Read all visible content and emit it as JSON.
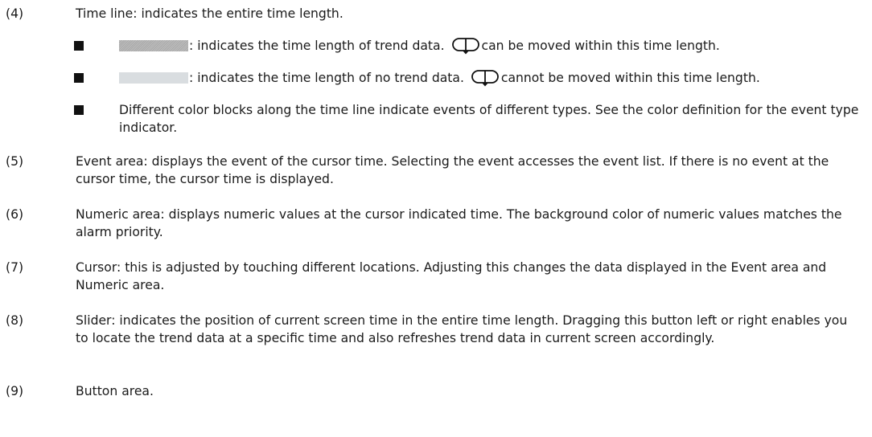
{
  "items": [
    {
      "num": "(4)",
      "text": "Time line: indicates the entire time length.",
      "bullets": [
        {
          "swatch": "trend",
          "pre": ": indicates the time length of trend data.",
          "post": "can be moved within this time length."
        },
        {
          "swatch": "notrend",
          "pre": ": indicates the time length of no trend data.",
          "post": "cannot be moved within this time length."
        },
        {
          "text": "Different color blocks along the time line indicate events of different types. See the color definition for the event type indicator."
        }
      ]
    },
    {
      "num": "(5)",
      "text": "Event area: displays the event of the cursor time. Selecting the event accesses the event list. If there is no event at the cursor time, the cursor time is displayed."
    },
    {
      "num": "(6)",
      "text": "Numeric area: displays numeric values at the cursor indicated time. The background color of numeric values matches the alarm priority."
    },
    {
      "num": "(7)",
      "text": "Cursor: this is adjusted by touching different locations. Adjusting this changes the data displayed in the Event area and Numeric area."
    },
    {
      "num": "(8)",
      "text": "Slider: indicates the position of current screen time in the entire time length. Dragging this button left or right enables you to locate the trend data at a specific time and also refreshes trend data in current screen accordingly."
    },
    {
      "num": "(9)",
      "text": "Button area."
    }
  ],
  "colors": {
    "trend_swatch": "#b0b0b0",
    "no_trend_swatch": "#d9dde0",
    "text": "#1a1a1a"
  },
  "icons": {
    "cursor": "cursor-handle-icon"
  }
}
